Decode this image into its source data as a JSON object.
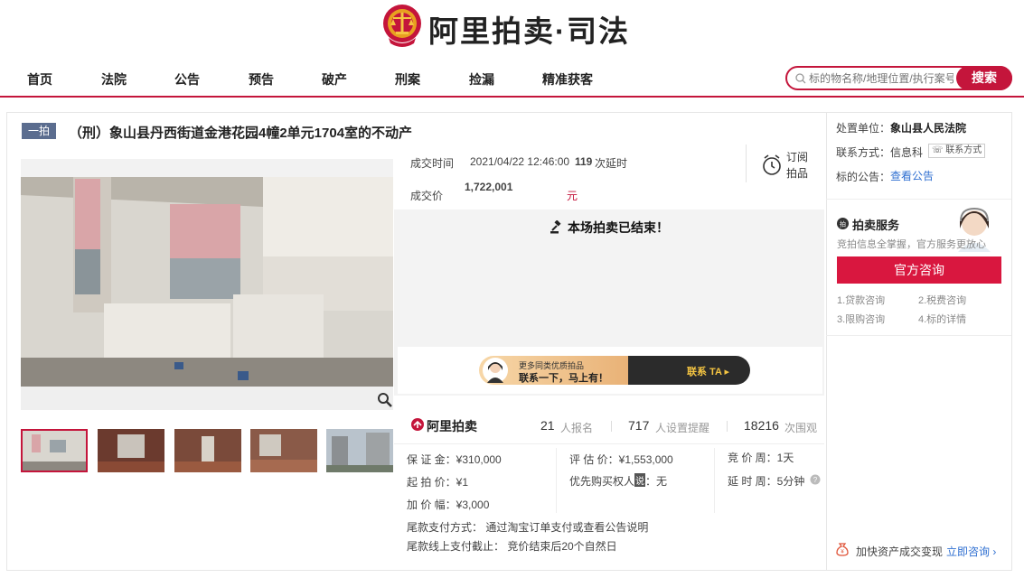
{
  "brand": {
    "name": "阿里拍卖·司法"
  },
  "nav": {
    "items": [
      "首页",
      "法院",
      "公告",
      "预告",
      "破产",
      "刑案",
      "捡漏",
      "精准获客"
    ]
  },
  "search": {
    "placeholder": "标的物名称/地理位置/执行案号",
    "button": "搜索"
  },
  "item": {
    "badge": "一拍",
    "title": "（刑）象山县丹西街道金港花园4幢2单元1704室的不动产"
  },
  "deal": {
    "time_label": "成交时间",
    "time_value": "2021/04/22 12:46:00",
    "delay_count": "119",
    "delay_label": "次延时",
    "subscribe_line1": "订阅",
    "subscribe_line2": "拍品",
    "price_label": "成交价",
    "price": "1,722,001",
    "price_unit": "元",
    "ended": "本场拍卖已结束！"
  },
  "promo": {
    "line1": "更多同类优质拍品",
    "line2": "联系一下，马上有！",
    "cta": "联系 TA ▸"
  },
  "stats": {
    "logo": "阿里拍卖",
    "signups": "21",
    "signups_label": "人报名",
    "reminders": "717",
    "reminders_label": "人设置提醒",
    "views": "18216",
    "views_label": "次围观"
  },
  "details": {
    "deposit": "保 证 金：¥310,000",
    "assessed": "评 估 价：¥1,553,000",
    "bid_period": "竞 价 周：1天",
    "start_price": "起 拍 价：¥1",
    "priority": "优先购买权人",
    "priority_tag": "说",
    "priority_value": "：无",
    "delay_period": "延 时 周：5分钟",
    "increment": "加 价 幅：¥3,000",
    "payment_method": "尾款支付方式：  通过淘宝订单支付或查看公告说明",
    "payment_deadline": "尾款线上支付截止：  竞价结束后20个自然日"
  },
  "side": {
    "unit_label": "处置单位：",
    "unit_value": "象山县人民法院",
    "contact_label": "联系方式：",
    "contact_value": "信息科",
    "contact_btn": "联系方式",
    "notice_label": "标的公告：",
    "notice_link": "查看公告",
    "service_title": "拍卖服务",
    "service_sub": "竞拍信息全掌握，官方服务更放心",
    "consult_btn": "官方咨询",
    "links": [
      "1.贷款咨询",
      "2.税费咨询",
      "3.限购咨询",
      "4.标的详情"
    ],
    "footer_text": "加快资产成交变现",
    "footer_link": "立即咨询 ›"
  },
  "colors": {
    "accent": "#c4153b",
    "link": "#2f6fd1",
    "badge": "#5b6d8f"
  }
}
